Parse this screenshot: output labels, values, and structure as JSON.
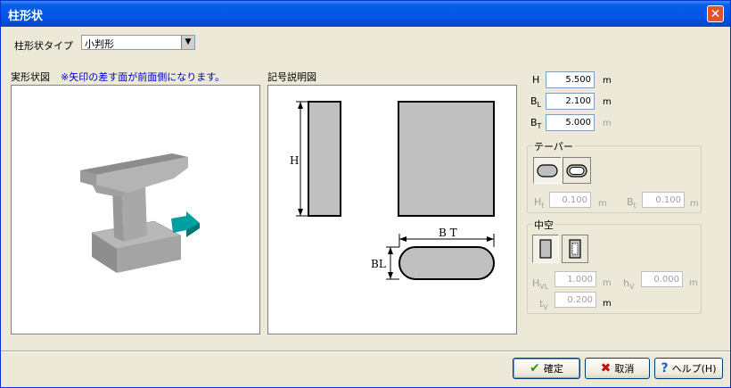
{
  "window": {
    "title": "柱形状"
  },
  "shape_type": {
    "label": "柱形状タイプ",
    "value": "小判形"
  },
  "left_panel": {
    "title": "実形状図",
    "note": "※矢印の差す面が前面側になります。"
  },
  "middle_panel": {
    "title": "記号説明図",
    "label_h": "H",
    "label_bt": "B T",
    "label_bl": "BL"
  },
  "params": {
    "H": {
      "label": "H",
      "value": "5.500",
      "unit": "m"
    },
    "BL": {
      "label": "B",
      "sub": "L",
      "value": "2.100",
      "unit": "m"
    },
    "BT": {
      "label": "B",
      "sub": "T",
      "value": "5.000",
      "unit": "m"
    }
  },
  "taper": {
    "title": "テーパー",
    "Ht": {
      "label": "H",
      "sub": "t",
      "value": "0.100",
      "unit": "m"
    },
    "Bt": {
      "label": "B",
      "sub": "t",
      "value": "0.100",
      "unit": "m"
    }
  },
  "hollow": {
    "title": "中空",
    "HVL": {
      "label": "H",
      "sub": "VL",
      "value": "1.000",
      "unit": "m"
    },
    "hV": {
      "label": "h",
      "sub": "V",
      "value": "0.000",
      "unit": "m"
    },
    "tV": {
      "label": "t",
      "sub": "V",
      "value": "0.200",
      "unit": "m"
    }
  },
  "buttons": {
    "ok": "確定",
    "cancel": "取消",
    "help": "ヘルプ(H)"
  },
  "colors": {
    "title_bar": "#0055e5",
    "dialog_bg": "#ece9d8",
    "note_text": "#0000c0",
    "diagram_fill": "#c0c0c0"
  }
}
